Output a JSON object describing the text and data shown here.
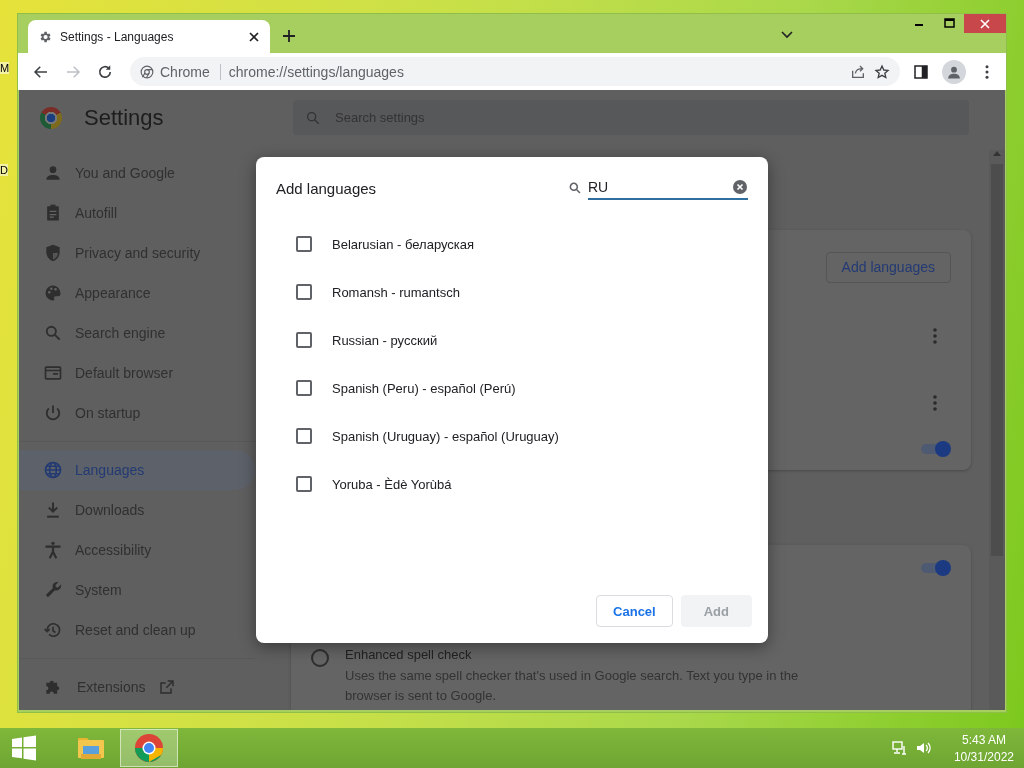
{
  "desktop": {
    "icon_labels": [
      "M",
      "D"
    ]
  },
  "browser": {
    "tab": {
      "title": "Settings - Languages"
    },
    "forward": {
      "disabled": true
    },
    "address": {
      "site_chip": "Chrome",
      "url": "chrome://settings/languages"
    }
  },
  "settings": {
    "title": "Settings",
    "search": {
      "placeholder": "Search settings"
    },
    "nav_groups": [
      {
        "items": [
          {
            "label": "You and Google",
            "selected": false
          },
          {
            "label": "Autofill",
            "selected": false
          },
          {
            "label": "Privacy and security",
            "selected": false
          },
          {
            "label": "Appearance",
            "selected": false
          },
          {
            "label": "Search engine",
            "selected": false
          },
          {
            "label": "Default browser",
            "selected": false
          },
          {
            "label": "On startup",
            "selected": false
          }
        ]
      },
      {
        "items": [
          {
            "label": "Languages",
            "selected": true
          },
          {
            "label": "Downloads",
            "selected": false
          },
          {
            "label": "Accessibility",
            "selected": false
          },
          {
            "label": "System",
            "selected": false
          },
          {
            "label": "Reset and clean up",
            "selected": false
          }
        ]
      },
      {
        "items": [
          {
            "label": "Extensions",
            "selected": false,
            "kind": "external"
          }
        ]
      }
    ],
    "languages_card": {
      "add_button": "Add languages",
      "toggle": {
        "on": true
      }
    },
    "spell_card": {
      "toggle": {
        "on": true
      },
      "option": {
        "label": "Enhanced spell check",
        "description": "Uses the same spell checker that's used in Google search. Text you type in the browser is sent to Google.",
        "selected": false
      }
    }
  },
  "dialog": {
    "title": "Add languages",
    "search": {
      "value": "RU"
    },
    "languages": [
      {
        "label": "Belarusian - беларуская",
        "checked": false
      },
      {
        "label": "Romansh - rumantsch",
        "checked": false
      },
      {
        "label": "Russian - русский",
        "checked": false
      },
      {
        "label": "Spanish (Peru) - español (Perú)",
        "checked": false
      },
      {
        "label": "Spanish (Uruguay) - español (Uruguay)",
        "checked": false
      },
      {
        "label": "Yoruba - Èdè Yorùbá",
        "checked": false
      }
    ],
    "buttons": [
      {
        "label": "Cancel",
        "disabled": false
      },
      {
        "label": "Add",
        "disabled": true
      }
    ]
  },
  "taskbar": {
    "apps": [
      {
        "selected": false
      },
      {
        "selected": true
      }
    ],
    "time": "5:43 AM",
    "date": "10/31/2022"
  }
}
